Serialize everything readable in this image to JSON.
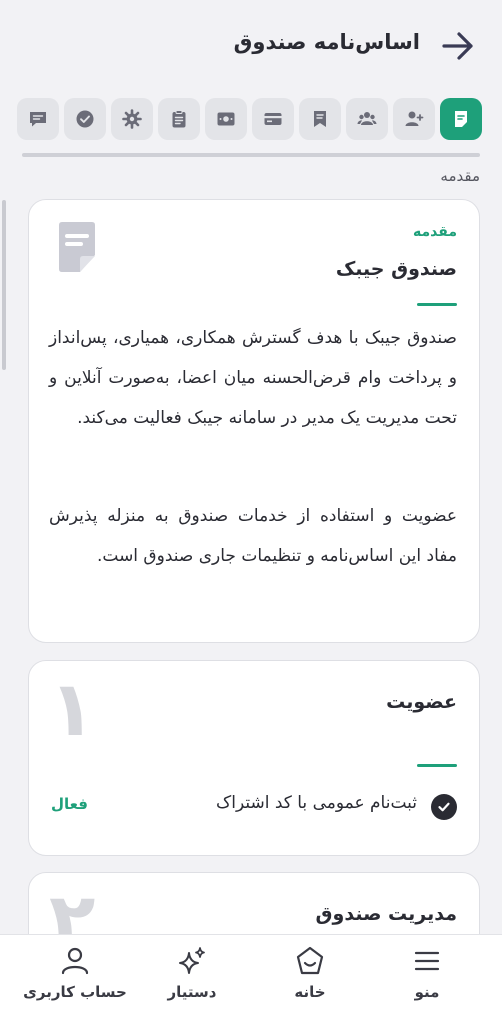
{
  "header": {
    "title": "اساس‌نامه صندوق",
    "back_icon": "arrow-right-icon"
  },
  "tabs": [
    {
      "icon": "document-icon",
      "active": true
    },
    {
      "icon": "user-add-icon",
      "active": false
    },
    {
      "icon": "users-icon",
      "active": false
    },
    {
      "icon": "bookmark-icon",
      "active": false
    },
    {
      "icon": "card-icon",
      "active": false
    },
    {
      "icon": "money-icon",
      "active": false
    },
    {
      "icon": "clipboard-icon",
      "active": false
    },
    {
      "icon": "gear-icon",
      "active": false
    },
    {
      "icon": "check-circle-icon",
      "active": false
    },
    {
      "icon": "message-icon",
      "active": false
    }
  ],
  "section_caption": "مقدمه",
  "intro_card": {
    "kicker": "مقدمه",
    "title": "صندوق جیبک",
    "paragraph1": "صندوق جیبک با هدف گسترش همکاری، همیاری، پس‌انداز و پرداخت وام قرض‌الحسنه میان اعضا، به‌صورت آنلاین و تحت مدیریت یک مدیر در سامانه جیبک فعالیت می‌کند.",
    "paragraph2": "عضویت و استفاده از خدمات صندوق به منزله پذیرش مفاد این اساس‌نامه و تنظیمات جاری صندوق است."
  },
  "membership_card": {
    "number": "۱",
    "title": "عضویت",
    "rule_label": "ثبت‌نام عمومی با کد اشتراک",
    "rule_status": "فعال"
  },
  "management_card": {
    "number": "۲",
    "title": "مدیریت صندوق"
  },
  "bottom_nav": {
    "menu": "منو",
    "home": "خانه",
    "assistant": "دستیار",
    "account": "حساب کاربری"
  },
  "colors": {
    "accent": "#1ea07a",
    "background": "#f2f2f5",
    "text": "#2a2b33"
  }
}
